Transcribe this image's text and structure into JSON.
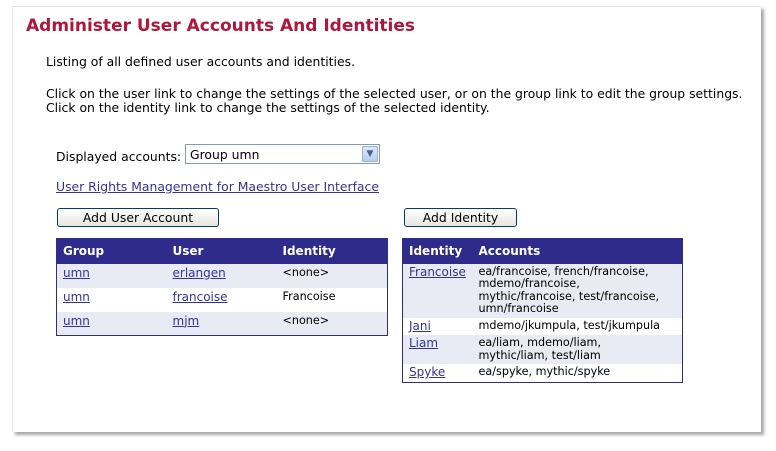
{
  "page": {
    "title": "Administer User Accounts And Identities",
    "intro": "Listing of all defined user accounts and identities.",
    "help_line1": "Click on the user link to change the settings of the selected user, or on the group link to edit the group settings.",
    "help_line2": "Click on the identity link to change the settings of the selected identity."
  },
  "filter": {
    "label": "Displayed accounts:",
    "selected": "Group umn",
    "arrow_icon": "chevron-down-icon"
  },
  "rights_link": "User Rights Management for Maestro User Interface",
  "buttons": {
    "add_user": "Add User Account",
    "add_identity": "Add Identity"
  },
  "colors": {
    "title": "#b0163a",
    "table_header": "#2e2b8a",
    "link": "#333399",
    "row_stripe": "#e8eaf4"
  },
  "users_table": {
    "headers": [
      "Group",
      "User",
      "Identity"
    ],
    "rows": [
      {
        "group": "umn",
        "user": "erlangen",
        "identity": "<none>"
      },
      {
        "group": "umn",
        "user": "francoise",
        "identity": "Francoise"
      },
      {
        "group": "umn",
        "user": "mjm",
        "identity": "<none>"
      }
    ]
  },
  "identities_table": {
    "headers": [
      "Identity",
      "Accounts"
    ],
    "rows": [
      {
        "identity": "Francoise",
        "accounts": [
          "ea/francoise, french/francoise,",
          "mdemo/francoise,",
          "mythic/francoise, test/francoise,",
          "umn/francoise"
        ]
      },
      {
        "identity": "Jani",
        "accounts": [
          "mdemo/jkumpula, test/jkumpula"
        ]
      },
      {
        "identity": "Liam",
        "accounts": [
          "ea/liam, mdemo/liam,",
          "mythic/liam, test/liam"
        ]
      },
      {
        "identity": "Spyke",
        "accounts": [
          "ea/spyke, mythic/spyke"
        ]
      }
    ]
  }
}
